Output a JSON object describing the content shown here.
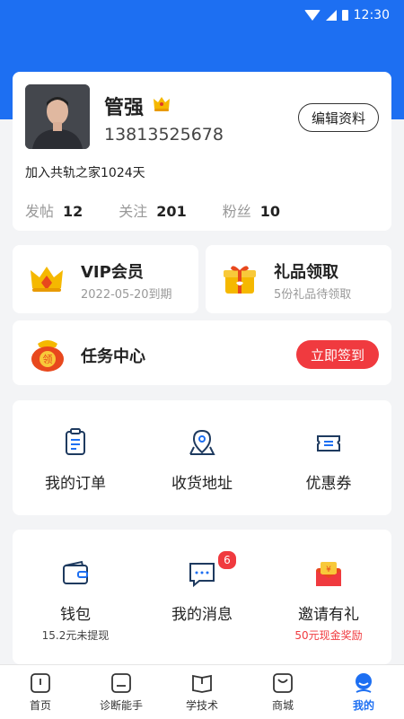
{
  "status_bar": {
    "time": "12:30"
  },
  "profile": {
    "name": "管强",
    "phone": "13813525678",
    "edit_label": "编辑资料",
    "joined": "加入共轨之家1024天",
    "stats": [
      {
        "label": "发帖",
        "value": "12"
      },
      {
        "label": "关注",
        "value": "201"
      },
      {
        "label": "粉丝",
        "value": "10"
      }
    ]
  },
  "vip": {
    "title": "VIP会员",
    "sub": "2022-05-20到期"
  },
  "gift": {
    "title": "礼品领取",
    "sub": "5份礼品待领取"
  },
  "task": {
    "title": "任务中心",
    "icon_text": "领",
    "button": "立即签到"
  },
  "orders_grid": [
    {
      "label": "我的订单",
      "icon": "order-icon"
    },
    {
      "label": "收货地址",
      "icon": "address-icon"
    },
    {
      "label": "优惠券",
      "icon": "coupon-icon"
    }
  ],
  "wallet_grid": [
    {
      "label": "钱包",
      "sub": "15.2元未提现",
      "icon": "wallet-icon"
    },
    {
      "label": "我的消息",
      "badge": "6",
      "icon": "message-icon"
    },
    {
      "label": "邀请有礼",
      "sub": "50元现金奖励",
      "icon": "invite-gift-icon"
    }
  ],
  "tabs": [
    {
      "label": "首页",
      "icon": "home-icon"
    },
    {
      "label": "诊断能手",
      "icon": "diagnosis-icon"
    },
    {
      "label": "学技术",
      "icon": "book-icon"
    },
    {
      "label": "商城",
      "icon": "shop-icon"
    },
    {
      "label": "我的",
      "icon": "profile-icon",
      "active": true
    }
  ],
  "colors": {
    "primary": "#1d6ff2",
    "danger": "#f03a3f",
    "gold": "#f5b800"
  }
}
